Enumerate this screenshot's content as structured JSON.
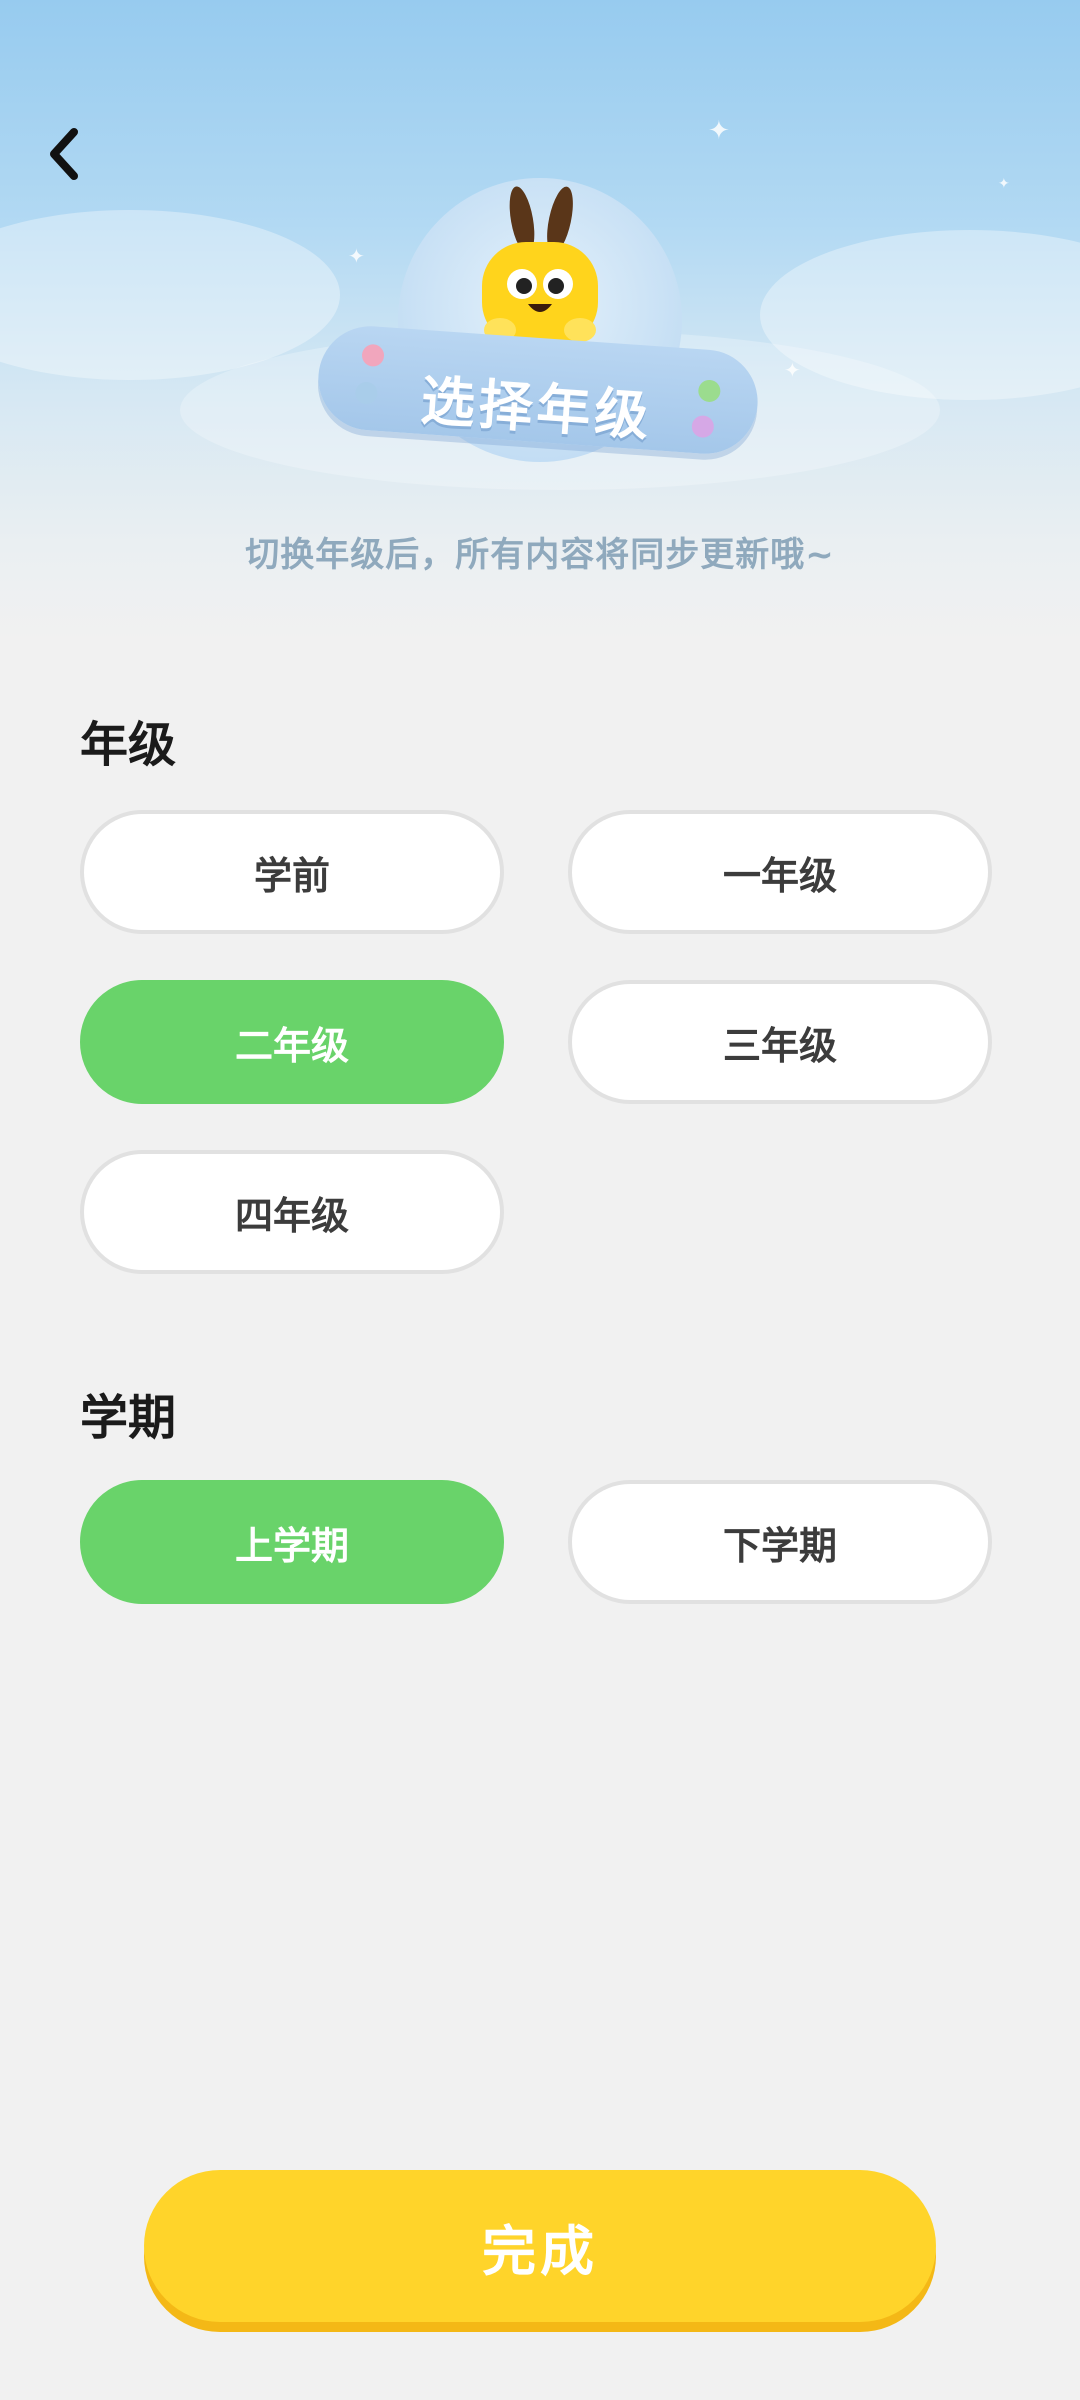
{
  "header": {
    "title": "选择年级",
    "subtitle": "切换年级后，所有内容将同步更新哦~",
    "back_icon": "chevron-left-icon"
  },
  "grade_section": {
    "title": "年级",
    "options": [
      {
        "label": "学前",
        "selected": false
      },
      {
        "label": "一年级",
        "selected": false
      },
      {
        "label": "二年级",
        "selected": true
      },
      {
        "label": "三年级",
        "selected": false
      },
      {
        "label": "四年级",
        "selected": false
      }
    ]
  },
  "term_section": {
    "title": "学期",
    "options": [
      {
        "label": "上学期",
        "selected": true
      },
      {
        "label": "下学期",
        "selected": false
      }
    ]
  },
  "footer": {
    "done_label": "完成"
  },
  "colors": {
    "selected": "#69d36a",
    "done_button": "#ffd42a",
    "sky_top": "#97cbef"
  }
}
